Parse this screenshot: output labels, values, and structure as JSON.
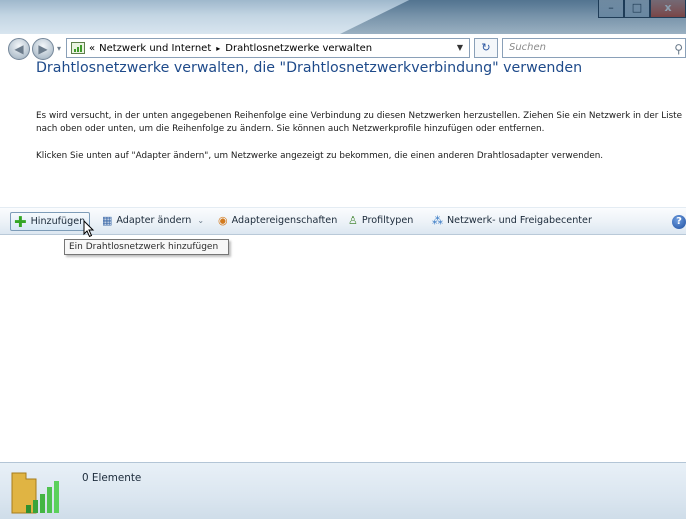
{
  "window": {
    "minimize_symbol": "–",
    "maximize_symbol": "□",
    "close_symbol": "x"
  },
  "navigation": {
    "back_symbol": "◀",
    "forward_symbol": "▶",
    "breadcrumb_prefix": "«",
    "breadcrumbs": [
      "Netzwerk und Internet",
      "Drahtlosnetzwerke verwalten"
    ],
    "breadcrumb_separator": "▸",
    "search_placeholder": "Suchen"
  },
  "page": {
    "heading": "Drahtlosnetzwerke verwalten, die \"Drahtlosnetzwerkverbindung\" verwenden",
    "description_1": "Es wird versucht, in der unten angegebenen Reihenfolge eine Verbindung zu diesen Netzwerken herzustellen. Ziehen Sie ein Netzwerk in der Liste nach oben oder unten, um die Reihenfolge zu ändern. Sie können auch Netzwerkprofile hinzufügen oder entfernen.",
    "description_2": "Klicken Sie unten auf \"Adapter ändern\", um Netzwerke angezeigt zu bekommen, die einen anderen Drahtlosadapter verwenden."
  },
  "toolbar": {
    "add_label": "Hinzufügen",
    "change_adapter_label": "Adapter ändern",
    "adapter_properties_label": "Adaptereigenschaften",
    "profile_types_label": "Profiltypen",
    "network_center_label": "Netzwerk- und Freigabecenter",
    "help_symbol": "?"
  },
  "tooltip": {
    "text": "Ein Drahtlosnetzwerk hinzufügen"
  },
  "status": {
    "item_count": "0 Elemente"
  },
  "icons": {
    "search": "search-icon",
    "refresh": "refresh-icon",
    "network": "network-icon",
    "add": "plus-icon",
    "adapter": "adapter-icon",
    "properties": "properties-icon",
    "profile": "user-icon",
    "network_center": "network-center-icon",
    "help": "help-icon",
    "status": "wireless-signal-icon"
  }
}
